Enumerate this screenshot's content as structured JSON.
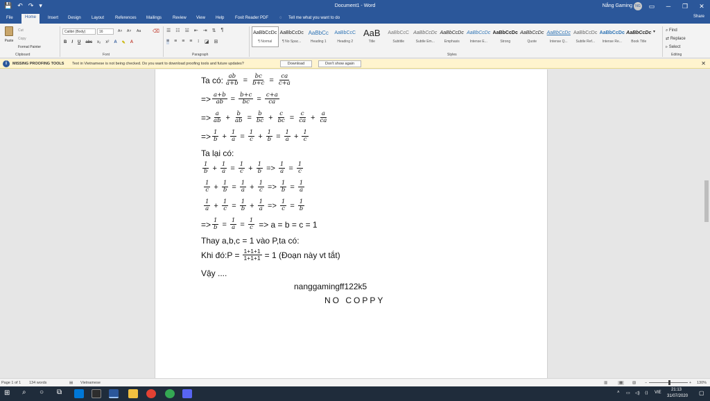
{
  "window": {
    "title": "Document1 - Word",
    "user": "Nắng Gaming",
    "avatar": "NG",
    "qat": [
      "💾",
      "↶",
      "↷",
      "▾"
    ],
    "controls": [
      "▭",
      "─",
      "❐",
      "✕"
    ]
  },
  "tabs": [
    "File",
    "Home",
    "Insert",
    "Design",
    "Layout",
    "References",
    "Mailings",
    "Review",
    "View",
    "Help",
    "Foxit Reader PDF"
  ],
  "active_tab": "Home",
  "tell_me": "Tell me what you want to do",
  "share": "Share",
  "ribbon": {
    "clipboard": {
      "paste": "Paste",
      "cut": "Cut",
      "copy": "Copy",
      "format_painter": "Format Painter",
      "label": "Clipboard"
    },
    "font": {
      "family": "Calibri (Body)",
      "size": "16",
      "grow": "A˄",
      "shrink": "A˅",
      "case": "Aa",
      "bold": "B",
      "italic": "I",
      "underline": "U",
      "strike": "abc",
      "sub": "x₂",
      "sup": "x²",
      "label": "Font"
    },
    "paragraph": {
      "label": "Paragraph"
    },
    "styles": {
      "label": "Styles",
      "items": [
        {
          "preview": "AaBbCcDc",
          "name": "¶ Normal"
        },
        {
          "preview": "AaBbCcDc",
          "name": "¶ No Spac..."
        },
        {
          "preview": "AaBbCc",
          "name": "Heading 1"
        },
        {
          "preview": "AaBbCcC",
          "name": "Heading 2"
        },
        {
          "preview": "AaB",
          "name": "Title"
        },
        {
          "preview": "AaBbCcC",
          "name": "Subtitle"
        },
        {
          "preview": "AaBbCcDc",
          "name": "Subtle Em..."
        },
        {
          "preview": "AaBbCcDc",
          "name": "Emphasis"
        },
        {
          "preview": "AaBbCcDc",
          "name": "Intense E..."
        },
        {
          "preview": "AaBbCcDc",
          "name": "Strong"
        },
        {
          "preview": "AaBbCcDc",
          "name": "Quote"
        },
        {
          "preview": "AaBbCcDc",
          "name": "Intense Q..."
        },
        {
          "preview": "AaBbCcDc",
          "name": "Subtle Ref..."
        },
        {
          "preview": "AaBbCcDc",
          "name": "Intense Re..."
        },
        {
          "preview": "AaBbCcDc",
          "name": "Book Title"
        }
      ]
    },
    "editing": {
      "find": "Find",
      "replace": "Replace",
      "select": "Select",
      "label": "Editing"
    }
  },
  "message_bar": {
    "title": "MISSING PROOFING TOOLS",
    "text": "Text in Vietnamese is not being checked. Do you want to download proofing tools and future updates?",
    "download": "Download",
    "dismiss": "Don't show again"
  },
  "doc": {
    "l1_prefix": "Ta có:",
    "l1": [
      [
        "ab",
        "a+b"
      ],
      [
        "bc",
        "b+c"
      ],
      [
        "ca",
        "c+a"
      ]
    ],
    "l2": [
      [
        "a+b",
        "ab"
      ],
      [
        "b+c",
        "bc"
      ],
      [
        "c+a",
        "ca"
      ]
    ],
    "l3": [
      [
        "a",
        "ab"
      ],
      [
        "b",
        "ab"
      ],
      [
        "b",
        "bc"
      ],
      [
        "c",
        "bc"
      ],
      [
        "c",
        "ca"
      ],
      [
        "a",
        "ca"
      ]
    ],
    "l4": [
      [
        "1",
        "b"
      ],
      [
        "1",
        "a"
      ],
      [
        "1",
        "c"
      ],
      [
        "1",
        "b"
      ],
      [
        "1",
        "a"
      ],
      [
        "1",
        "c"
      ]
    ],
    "ta_lai_co": "Ta lại có:",
    "l6": [
      [
        "1",
        "b"
      ],
      [
        "1",
        "a"
      ],
      [
        "1",
        "c"
      ],
      [
        "1",
        "b"
      ],
      [
        "1",
        "a"
      ],
      [
        "1",
        "c"
      ]
    ],
    "l7": [
      [
        "1",
        "c"
      ],
      [
        "1",
        "b"
      ],
      [
        "1",
        "a"
      ],
      [
        "1",
        "c"
      ],
      [
        "1",
        "b"
      ],
      [
        "1",
        "a"
      ]
    ],
    "l8": [
      [
        "1",
        "a"
      ],
      [
        "1",
        "c"
      ],
      [
        "1",
        "b"
      ],
      [
        "1",
        "a"
      ],
      [
        "1",
        "c"
      ],
      [
        "1",
        "b"
      ]
    ],
    "l9": [
      [
        "1",
        "b"
      ],
      [
        "1",
        "a"
      ],
      [
        "1",
        "c"
      ]
    ],
    "l9_tail": "=> a = b = c = 1",
    "thay": "Thay a,b,c = 1 vào P,ta có:",
    "khi_do_prefix": "Khi đó:P =",
    "khi_do_num": "1+1+1",
    "khi_do_den": "1+1+1",
    "khi_do_tail": "= 1 (Đoạn này vt tắt)",
    "vay": "Vậy ....",
    "signature": "nanggamingff122k5",
    "no_copy": "NO COPPY",
    "arrow": "=>",
    "eq": "=",
    "plus": "+"
  },
  "status": {
    "page": "Page 1 of 1",
    "words": "134 words",
    "language": "Vietnamese",
    "zoom": "130%"
  },
  "taskbar": {
    "search": "⌕",
    "lang": "VIE",
    "time": "21:13",
    "date": "31/07/2020"
  }
}
